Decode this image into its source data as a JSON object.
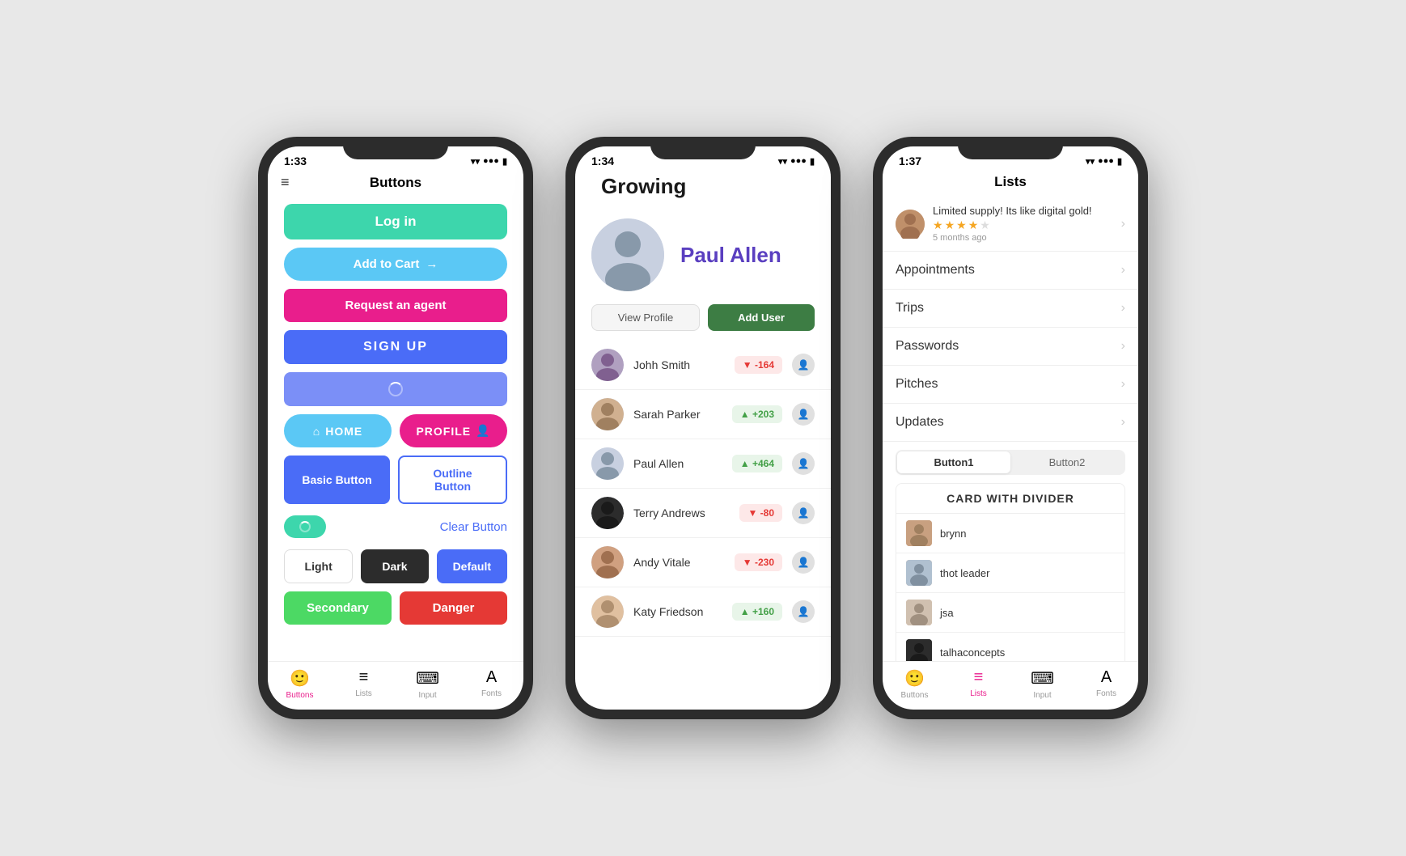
{
  "phone1": {
    "status_time": "1:33",
    "title": "Buttons",
    "buttons": {
      "login": "Log in",
      "cart": "Add to Cart",
      "agent": "Request an agent",
      "signup": "SIGN UP",
      "home": "HOME",
      "profile": "PROFILE",
      "basic": "Basic Button",
      "outline": "Outline Button",
      "clear": "Clear Button",
      "light": "Light",
      "dark": "Dark",
      "default": "Default",
      "secondary": "Secondary",
      "danger": "Danger"
    },
    "tabs": {
      "buttons": "Buttons",
      "lists": "Lists",
      "input": "Input",
      "fonts": "Fonts"
    }
  },
  "phone2": {
    "status_time": "1:34",
    "title": "Growing",
    "profile": {
      "name": "Paul Allen"
    },
    "actions": {
      "view_profile": "View Profile",
      "add_user": "Add User"
    },
    "users": [
      {
        "name": "Johh Smith",
        "score": "-164",
        "type": "negative"
      },
      {
        "name": "Sarah Parker",
        "score": "+203",
        "type": "positive"
      },
      {
        "name": "Paul Allen",
        "score": "+464",
        "type": "positive"
      },
      {
        "name": "Terry Andrews",
        "score": "-80",
        "type": "negative"
      },
      {
        "name": "Andy Vitale",
        "score": "-230",
        "type": "negative"
      },
      {
        "name": "Katy Friedson",
        "score": "+160",
        "type": "positive"
      }
    ]
  },
  "phone3": {
    "status_time": "1:37",
    "title": "Lists",
    "review": {
      "text": "Limited supply! Its like digital gold!",
      "time": "5 months ago",
      "stars": 4
    },
    "list_items": [
      "Appointments",
      "Trips",
      "Passwords",
      "Pitches",
      "Updates"
    ],
    "segments": [
      "Button1",
      "Button2"
    ],
    "card_title": "CARD WITH DIVIDER",
    "card_items": [
      "brynn",
      "thot leader",
      "jsa",
      "talhaconcepts"
    ],
    "tabs": {
      "buttons": "Buttons",
      "lists": "Lists",
      "input": "Input",
      "fonts": "Fonts"
    }
  }
}
